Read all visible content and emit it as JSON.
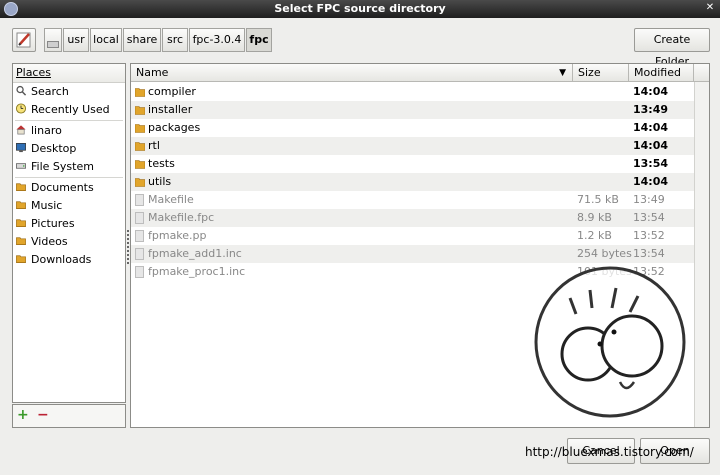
{
  "window": {
    "title": "Select FPC source directory"
  },
  "pathbar": {
    "crumbs": [
      {
        "label": ""
      },
      {
        "label": "usr"
      },
      {
        "label": "local"
      },
      {
        "label": "share"
      },
      {
        "label": "src"
      },
      {
        "label": "fpc-3.0.4"
      },
      {
        "label": "fpc"
      }
    ],
    "create_folder": "Create Folder"
  },
  "places": {
    "header": "Places",
    "items": [
      {
        "label": "Search",
        "icon": "search-icon"
      },
      {
        "label": "Recently Used",
        "icon": "clock-icon"
      },
      {
        "label": "linaro",
        "icon": "home-icon"
      },
      {
        "label": "Desktop",
        "icon": "desktop-icon"
      },
      {
        "label": "File System",
        "icon": "drive-icon"
      },
      {
        "label": "Documents",
        "icon": "folder-icon"
      },
      {
        "label": "Music",
        "icon": "folder-icon"
      },
      {
        "label": "Pictures",
        "icon": "folder-icon"
      },
      {
        "label": "Videos",
        "icon": "folder-icon"
      },
      {
        "label": "Downloads",
        "icon": "folder-icon"
      }
    ],
    "add_symbol": "+",
    "remove_symbol": "−"
  },
  "files": {
    "columns": {
      "name": "Name",
      "size": "Size",
      "modified": "Modified"
    },
    "rows": [
      {
        "name": "compiler",
        "size": "",
        "modified": "14:04",
        "type": "dir"
      },
      {
        "name": "installer",
        "size": "",
        "modified": "13:49",
        "type": "dir"
      },
      {
        "name": "packages",
        "size": "",
        "modified": "14:04",
        "type": "dir"
      },
      {
        "name": "rtl",
        "size": "",
        "modified": "14:04",
        "type": "dir"
      },
      {
        "name": "tests",
        "size": "",
        "modified": "13:54",
        "type": "dir"
      },
      {
        "name": "utils",
        "size": "",
        "modified": "14:04",
        "type": "dir"
      },
      {
        "name": "Makefile",
        "size": "71.5 kB",
        "modified": "13:49",
        "type": "file"
      },
      {
        "name": "Makefile.fpc",
        "size": "8.9 kB",
        "modified": "13:54",
        "type": "file"
      },
      {
        "name": "fpmake.pp",
        "size": "1.2 kB",
        "modified": "13:52",
        "type": "file"
      },
      {
        "name": "fpmake_add1.inc",
        "size": "254 bytes",
        "modified": "13:54",
        "type": "file"
      },
      {
        "name": "fpmake_proc1.inc",
        "size": "101 bytes",
        "modified": "13:52",
        "type": "file"
      }
    ]
  },
  "buttons": {
    "cancel": "Cancel",
    "open": "Open"
  },
  "watermark_url": "http://bluexmas.tistory.com/",
  "colors": {
    "folder": "#e1a52b",
    "titlebar": "#2b2b2b",
    "selected_crumb": "#d9d9d4"
  }
}
